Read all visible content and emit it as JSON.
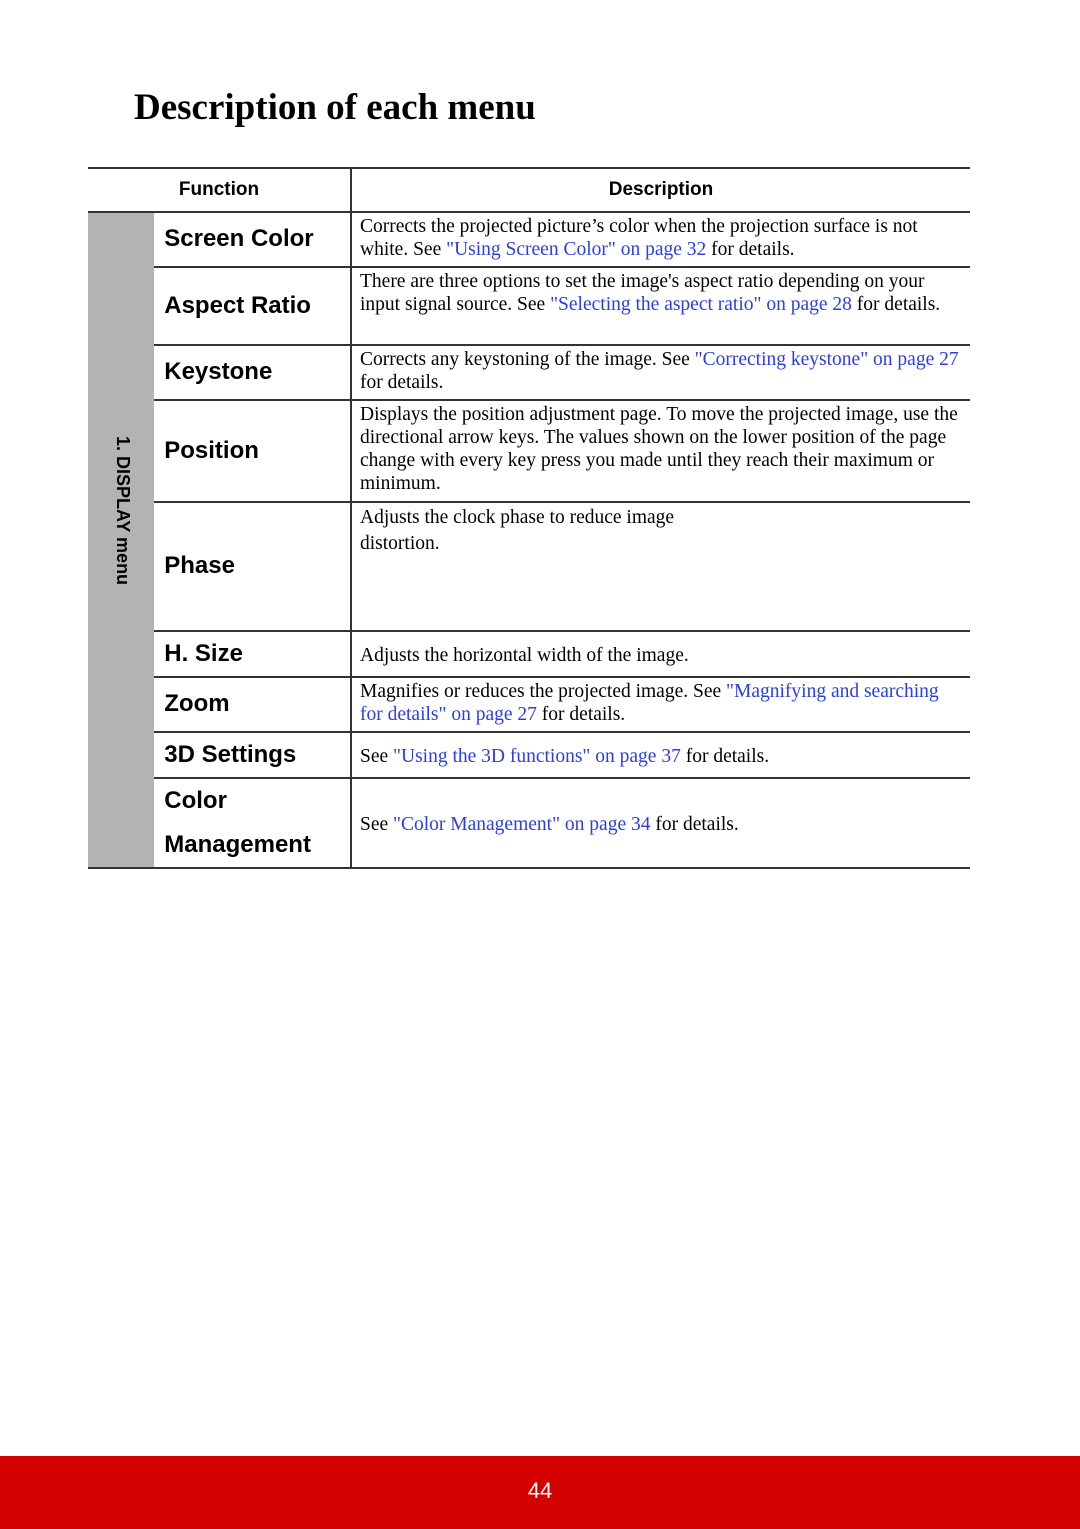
{
  "page": {
    "title": "Description of each menu",
    "page_number": "44",
    "colors": {
      "link": "#2b3fe0",
      "footer": "#d50000",
      "group_bg": "#b3b3b3"
    }
  },
  "table": {
    "headers": {
      "function": "Function",
      "description": "Description"
    },
    "group_label": "1. DISPLAY menu",
    "rows": [
      {
        "function": "Screen Color",
        "pre": "Corrects the projected picture’s color when the projection surface is not white. See ",
        "link": "\"Using Screen Color\" on page 32",
        "post": " for details."
      },
      {
        "function": "Aspect Ratio",
        "pre": "There are three options to set the image's aspect ratio depending on your input signal source. See ",
        "link": "\"Selecting the aspect ratio\" on page 28",
        "post": " for details."
      },
      {
        "function": "Keystone",
        "pre": "Corrects any keystoning of the image. See ",
        "link": "\"Correcting keystone\" on page 27",
        "post": " for details."
      },
      {
        "function": "Position",
        "pre": "Displays the position adjustment page. To move the projected image, use the directional arrow keys. The values shown on the lower position of the page change with every key press you made until they reach their maximum or minimum.",
        "link": "",
        "post": ""
      },
      {
        "function": "Phase",
        "pre": "Adjusts the clock phase to reduce image distortion.",
        "link": "",
        "post": ""
      },
      {
        "function": "H. Size",
        "pre": "Adjusts the horizontal width of the image.",
        "link": "",
        "post": ""
      },
      {
        "function": "Zoom",
        "pre": "Magnifies or reduces the projected image. See ",
        "link": "\"Magnifying and searching for details\" on page 27",
        "post": " for details."
      },
      {
        "function": "3D Settings",
        "pre": "See ",
        "link": "\"Using the 3D functions\" on page 37",
        "post": " for details."
      },
      {
        "function": "Color Management",
        "pre": "See ",
        "link": "\"Color Management\" on page 34",
        "post": " for details."
      }
    ]
  }
}
